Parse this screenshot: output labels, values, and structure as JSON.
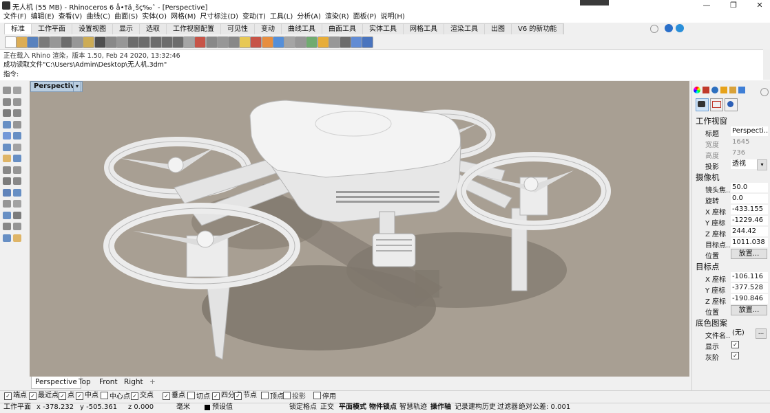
{
  "window": {
    "title": "无人机 (55 MB) - Rhinoceros 6 å•†ä¸šç‰ˆ - [Perspective]",
    "min_glyph": "—",
    "max_glyph": "❐",
    "close_glyph": "✕"
  },
  "menu": [
    "文件(F)",
    "编辑(E)",
    "查看(V)",
    "曲线(C)",
    "曲面(S)",
    "实体(O)",
    "网格(M)",
    "尺寸标注(D)",
    "变动(T)",
    "工具(L)",
    "分析(A)",
    "渲染(R)",
    "面板(P)",
    "说明(H)"
  ],
  "tabs": [
    {
      "label": "标准",
      "active": true
    },
    {
      "label": "工作平面"
    },
    {
      "label": "设置视图"
    },
    {
      "label": "显示"
    },
    {
      "label": "选取"
    },
    {
      "label": "工作视窗配置"
    },
    {
      "label": "可见性"
    },
    {
      "label": "变动"
    },
    {
      "label": "曲线工具"
    },
    {
      "label": "曲面工具"
    },
    {
      "label": "实体工具"
    },
    {
      "label": "网格工具"
    },
    {
      "label": "渲染工具"
    },
    {
      "label": "出图"
    },
    {
      "label": "V6 的新功能"
    }
  ],
  "command": {
    "line1": "正在载入 Rhino 渲染，版本 1.50, Feb 24 2020, 13:32:46",
    "line2": "成功读取文件\"C:\\Users\\Admin\\Desktop\\无人机.3dm\"",
    "prompt": "指令:"
  },
  "viewport": {
    "label": "Perspective",
    "dropdown_glyph": "▾",
    "tabs": [
      "Perspective",
      "Top",
      "Front",
      "Right"
    ],
    "add_tab_glyph": "+"
  },
  "osnap": [
    {
      "label": "端点",
      "checked": true
    },
    {
      "label": "最近点",
      "checked": true
    },
    {
      "label": "点",
      "checked": true
    },
    {
      "label": "中点",
      "checked": true
    },
    {
      "label": "中心点",
      "checked": false
    },
    {
      "label": "交点",
      "checked": true
    },
    {
      "label": "垂点",
      "checked": true
    },
    {
      "label": "切点",
      "checked": false
    },
    {
      "label": "四分点",
      "checked": true
    },
    {
      "label": "节点",
      "checked": true
    },
    {
      "label": "顶点",
      "checked": false
    },
    {
      "label": "投影",
      "checked": false
    },
    {
      "label": "停用",
      "checked": false
    }
  ],
  "status": {
    "cplane": "工作平面",
    "x": "x -378.232",
    "y": "y -505.361",
    "z": "z 0.000",
    "units": "毫米",
    "layer": "预设值",
    "grid_snap": "锁定格点",
    "ortho": "正交",
    "planar": "平面模式",
    "osnap": "物件锁点",
    "smarttrack": "智慧轨迹",
    "gumball": "操作轴",
    "history": "记录建构历史",
    "filter": "过滤器",
    "tolerance": "绝对公差: 0.001"
  },
  "properties": {
    "viewport_section": "工作视窗",
    "title_label": "标题",
    "title_value": "Perspecti...",
    "width_label": "宽度",
    "width_value": "1645",
    "height_label": "高度",
    "height_value": "736",
    "projection_label": "投影",
    "projection_value": "透视",
    "camera_section": "摄像机",
    "lens_label": "镜头焦...",
    "lens_value": "50.0",
    "rotation_label": "旋转",
    "rotation_value": "0.0",
    "cam_x_label": "X 座标",
    "cam_x_value": "-433.155",
    "cam_y_label": "Y 座标",
    "cam_y_value": "-1229.46",
    "cam_z_label": "Z 座标",
    "cam_z_value": "244.42",
    "target_dist_label": "目标点...",
    "target_dist_value": "1011.038",
    "cam_pos_label": "位置",
    "place_button": "放置...",
    "target_section": "目标点",
    "tgt_x_label": "X 座标",
    "tgt_x_value": "-106.116",
    "tgt_y_label": "Y 座标",
    "tgt_y_value": "-377.528",
    "tgt_z_label": "Z 座标",
    "tgt_z_value": "-190.846",
    "tgt_pos_label": "位置",
    "wallpaper_section": "底色图案",
    "file_label": "文件名...",
    "file_value": "(无)",
    "browse_button": "...",
    "show_label": "显示",
    "gray_label": "灰阶"
  },
  "colors": {
    "viewport_bg": "#a89f93",
    "model": "#e9e9e9",
    "shadow": "#7f776c",
    "active_label": "#b9cde0"
  }
}
